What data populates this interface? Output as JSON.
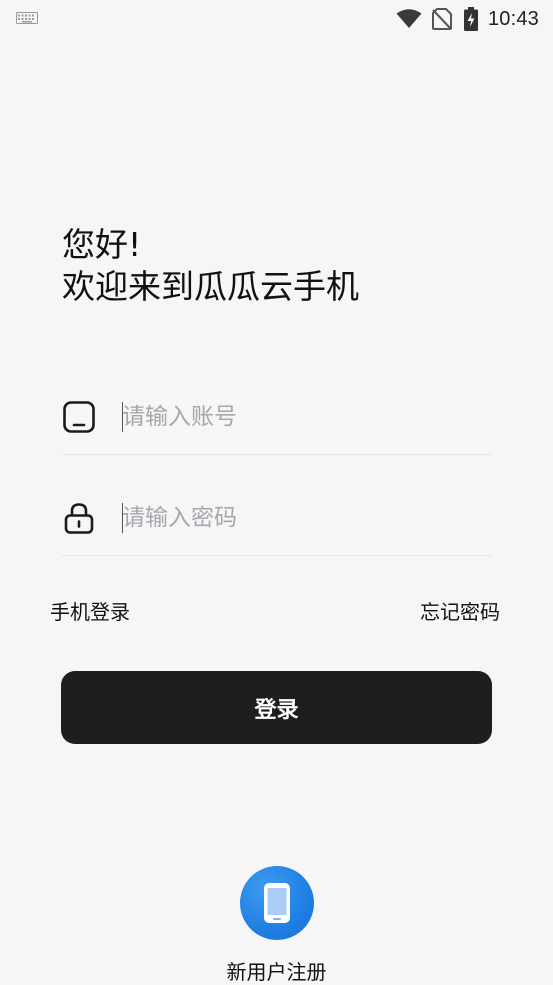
{
  "status_bar": {
    "time": "10:43",
    "icons": [
      "keyboard-icon",
      "wifi-icon",
      "no-sim-icon",
      "battery-charging-icon"
    ]
  },
  "greeting": {
    "line1": "您好!",
    "line2": "欢迎来到瓜瓜云手机"
  },
  "form": {
    "account": {
      "icon": "phone-icon",
      "placeholder": "请输入账号",
      "value": ""
    },
    "password": {
      "icon": "lock-icon",
      "placeholder": "请输入密码",
      "value": ""
    }
  },
  "links": {
    "phone_login": "手机登录",
    "forgot_password": "忘记密码"
  },
  "login_button": {
    "label": "登录"
  },
  "register": {
    "label": "新用户注册",
    "icon": "mobile-device-icon"
  },
  "colors": {
    "background": "#f6f6f6",
    "button": "#1e1e1e",
    "accent": "#1f7fe2",
    "placeholder": "#a6a6ae",
    "divider": "#e4e4ef"
  }
}
